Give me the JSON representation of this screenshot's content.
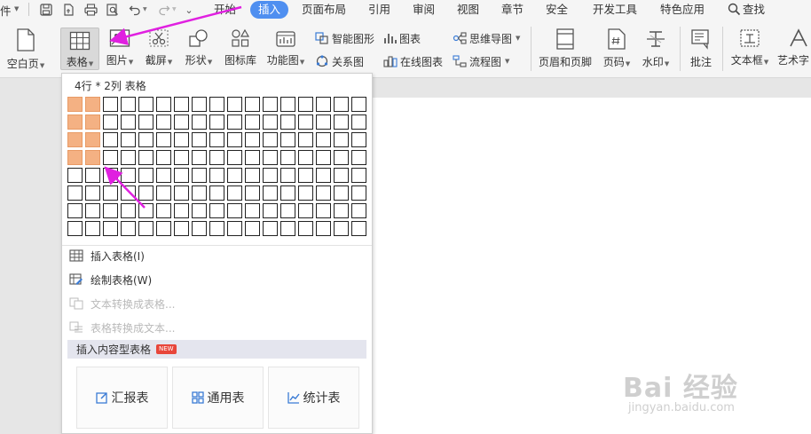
{
  "quick_access": {
    "partial_label": "件"
  },
  "menu": {
    "tabs": [
      {
        "label": "开始"
      },
      {
        "label": "插入"
      },
      {
        "label": "页面布局"
      },
      {
        "label": "引用"
      },
      {
        "label": "审阅"
      },
      {
        "label": "视图"
      },
      {
        "label": "章节"
      },
      {
        "label": "安全"
      },
      {
        "label": "开发工具"
      },
      {
        "label": "特色应用"
      },
      {
        "label": "查找"
      }
    ]
  },
  "ribbon": {
    "blank_page": "空白页",
    "table": "表格",
    "picture": "图片",
    "screenshot": "截屏",
    "shape": "形状",
    "icon_lib": "图标库",
    "function_chart": "功能图",
    "smart_shape": "智能图形",
    "chart": "图表",
    "mind_map": "思维导图",
    "relation_chart": "关系图",
    "online_chart": "在线图表",
    "flowchart": "流程图",
    "header_footer": "页眉和页脚",
    "page_number": "页码",
    "watermark": "水印",
    "comment": "批注",
    "textbox": "文本框",
    "art_text": "艺术字"
  },
  "dropdown": {
    "header": "4行 * 2列 表格",
    "grid": {
      "rows": 8,
      "cols": 17,
      "selected_rows": 4,
      "selected_cols": 2
    },
    "items": [
      {
        "label": "插入表格(I)"
      },
      {
        "label": "绘制表格(W)"
      },
      {
        "label": "文本转换成表格..."
      },
      {
        "label": "表格转换成文本..."
      }
    ],
    "section_title": "插入内容型表格",
    "new_badge": "NEW",
    "cards": [
      {
        "label": "汇报表"
      },
      {
        "label": "通用表"
      },
      {
        "label": "统计表"
      }
    ]
  },
  "watermark": {
    "logo": "Bai 经验",
    "url": "jingyan.baidu.com"
  },
  "colors": {
    "accent": "#4f8ff0",
    "selected_cell": "#f4b183",
    "annotation_arrow": "#e020e0",
    "new_badge": "#e8463a"
  }
}
